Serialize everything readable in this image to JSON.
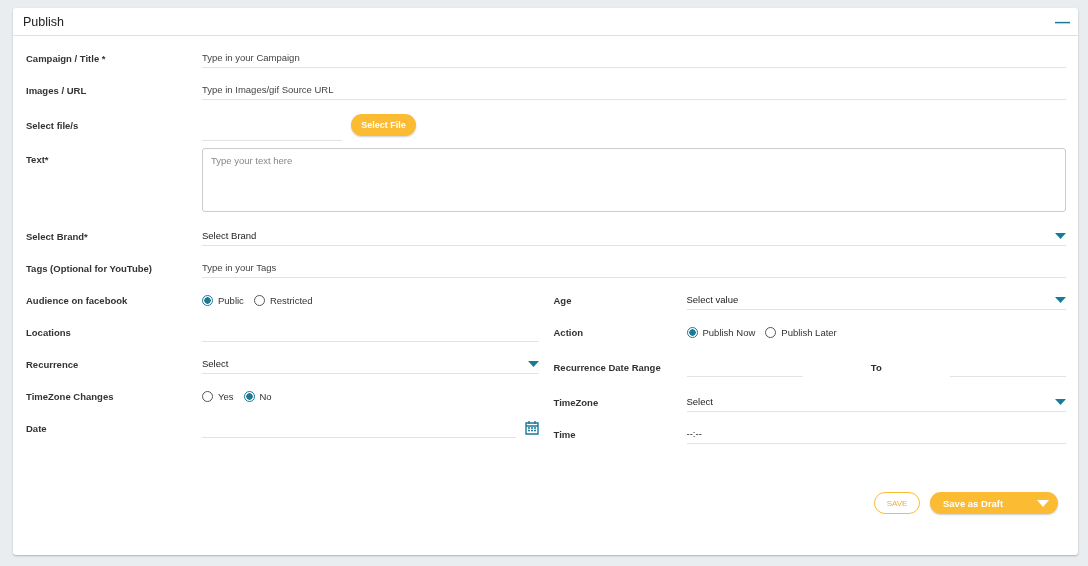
{
  "panel": {
    "title": "Publish",
    "collapse_symbol": "—"
  },
  "rows": [
    {
      "kind": "text",
      "label": "Campaign / Title *",
      "placeholder": "Type in your Campaign"
    },
    {
      "kind": "text",
      "label": "Images / URL",
      "placeholder": "Type in Images/gif Source URL"
    },
    {
      "kind": "file",
      "label": "Select file/s",
      "button": "Select File"
    },
    {
      "kind": "textarea",
      "label": "Text*",
      "placeholder": "Type your text here"
    },
    {
      "kind": "select",
      "label": "Select Brand*",
      "value": "Select Brand"
    },
    {
      "kind": "text",
      "label": "Tags (Optional for YouTube)",
      "placeholder": "Type in your Tags"
    }
  ],
  "columns": [
    {
      "rows": [
        {
          "kind": "radio",
          "label": "Audience on facebook",
          "options": [
            {
              "label": "Public",
              "selected": true
            },
            {
              "label": "Restricted",
              "selected": false
            }
          ]
        },
        {
          "kind": "text",
          "label": "Locations"
        },
        {
          "kind": "select",
          "label": "Recurrence",
          "value": "Select"
        },
        {
          "kind": "radio",
          "label": "TimeZone Changes",
          "options": [
            {
              "label": "Yes",
              "selected": false
            },
            {
              "label": "No",
              "selected": true
            }
          ]
        },
        {
          "kind": "date",
          "label": "Date"
        }
      ]
    },
    {
      "rows": [
        {
          "kind": "select",
          "label": "Age",
          "value": "Select value"
        },
        {
          "kind": "radio",
          "label": "Action",
          "options": [
            {
              "label": "Publish Now",
              "selected": true
            },
            {
              "label": "Publish Later",
              "selected": false
            }
          ]
        },
        {
          "kind": "range",
          "label": "Recurrence Date Range",
          "to_label": "To"
        },
        {
          "kind": "select",
          "label": "TimeZone",
          "value": "Select"
        },
        {
          "kind": "text",
          "label": "Time",
          "value": "--:--"
        }
      ]
    }
  ],
  "buttons": [
    {
      "kind": "outline",
      "label": "SAVE"
    },
    {
      "kind": "split",
      "label": "Save as Draft"
    }
  ]
}
